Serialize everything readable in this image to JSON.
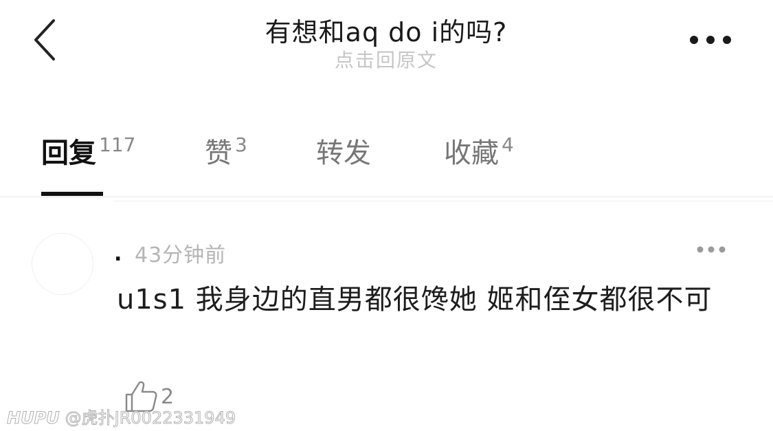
{
  "header": {
    "title": "有想和aq do i的吗?",
    "subtitle": "点击回原文",
    "back_icon": "chevron-left-icon",
    "more_icon": "more-horizontal-icon"
  },
  "tabs": [
    {
      "label": "回复",
      "count": "117",
      "active": true
    },
    {
      "label": "赞",
      "count": "3",
      "active": false
    },
    {
      "label": "转发",
      "count": "",
      "active": false
    },
    {
      "label": "收藏",
      "count": "4",
      "active": false
    }
  ],
  "reply": {
    "username": ".",
    "time": "43分钟前",
    "text": "u1s1 我身边的直男都很馋她 姬和侄女都很不可",
    "like_count": "2",
    "like_icon": "thumbs-up-icon",
    "more_icon": "more-horizontal-icon"
  },
  "watermark": {
    "brand": "HUPU",
    "handle": "@虎扑JR0022331949"
  },
  "colors": {
    "active_tab": "#111111",
    "inactive_tab": "#777777",
    "subtitle": "#c6c6c6",
    "timestamp": "#b5b5b5"
  }
}
